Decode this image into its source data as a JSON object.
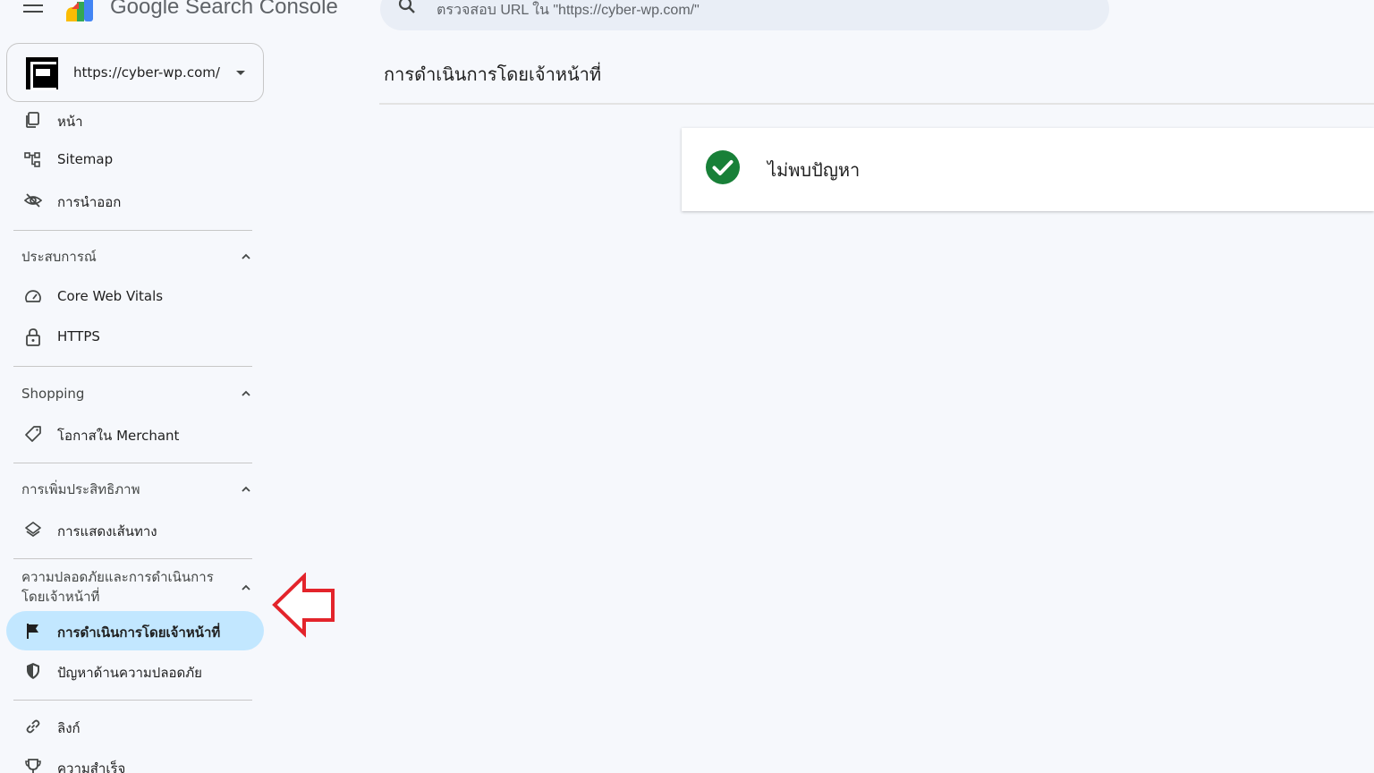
{
  "app": {
    "title": "Google Search Console"
  },
  "search": {
    "placeholder": "ตรวจสอบ URL ใน \"https://cyber-wp.com/\""
  },
  "property": {
    "url": "https://cyber-wp.com/"
  },
  "sidebar": {
    "top_items": [
      {
        "label": "หน้า",
        "icon": "pages-icon"
      },
      {
        "label": "Sitemap",
        "icon": "sitemap-icon"
      },
      {
        "label": "การนำออก",
        "icon": "removals-icon"
      }
    ],
    "sections": [
      {
        "title": "ประสบการณ์",
        "items": [
          {
            "label": "Core Web Vitals",
            "icon": "gauge-icon"
          },
          {
            "label": "HTTPS",
            "icon": "lock-icon"
          }
        ]
      },
      {
        "title": "Shopping",
        "items": [
          {
            "label": "โอกาสใน Merchant",
            "icon": "tag-icon"
          }
        ]
      },
      {
        "title": "การเพิ่มประสิทธิภาพ",
        "items": [
          {
            "label": "การแสดงเส้นทาง",
            "icon": "layers-icon"
          }
        ]
      },
      {
        "title_line1": "ความปลอดภัยและการดำเนินการ",
        "title_line2": "โดยเจ้าหน้าที่",
        "items": [
          {
            "label": "การดำเนินการโดยเจ้าหน้าที่",
            "icon": "flag-icon",
            "active": true
          },
          {
            "label": "ปัญหาด้านความปลอดภัย",
            "icon": "shield-icon"
          }
        ]
      }
    ],
    "bottom_items": [
      {
        "label": "ลิงก์",
        "icon": "link-icon"
      },
      {
        "label": "ความสำเร็จ",
        "icon": "trophy-icon"
      }
    ]
  },
  "main": {
    "page_title": "การดำเนินการโดยเจ้าหน้าที่",
    "status_message": "ไม่พบปัญหา"
  },
  "colors": {
    "active_bg": "#c2e7ff",
    "success_green": "#188038",
    "callout_red": "#e3242b"
  }
}
